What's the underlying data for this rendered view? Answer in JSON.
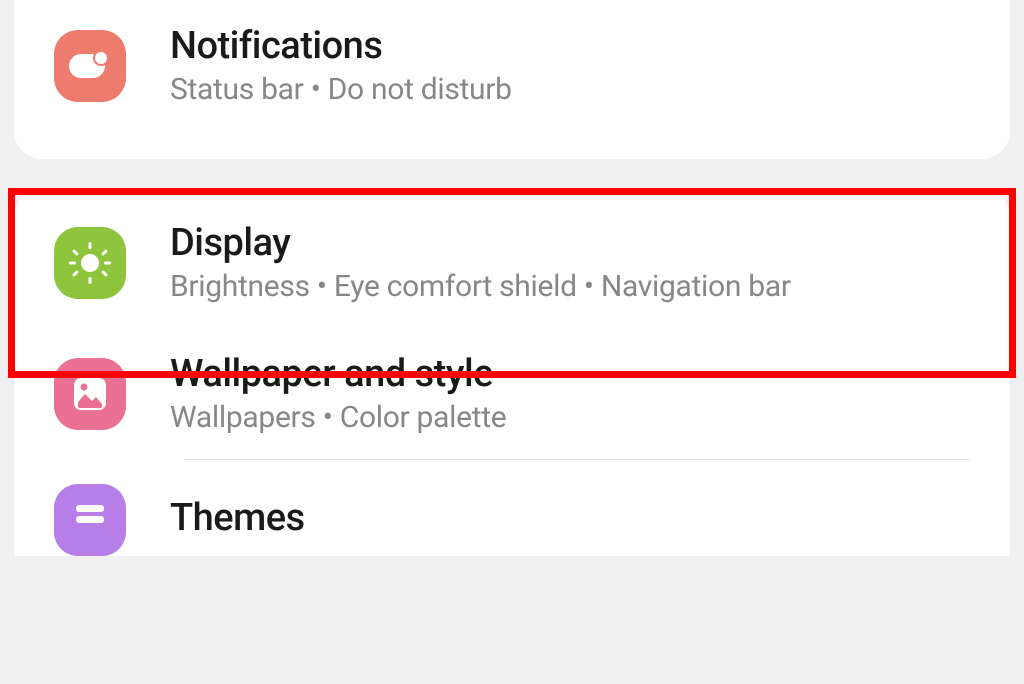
{
  "settings": {
    "notifications": {
      "title": "Notifications",
      "subtitle": "Status bar  •  Do not disturb"
    },
    "display": {
      "title": "Display",
      "subtitle": "Brightness  •  Eye comfort shield  •  Navigation bar"
    },
    "wallpaper": {
      "title": "Wallpaper and style",
      "subtitle": "Wallpapers  •  Color palette"
    },
    "themes": {
      "title": "Themes"
    }
  }
}
